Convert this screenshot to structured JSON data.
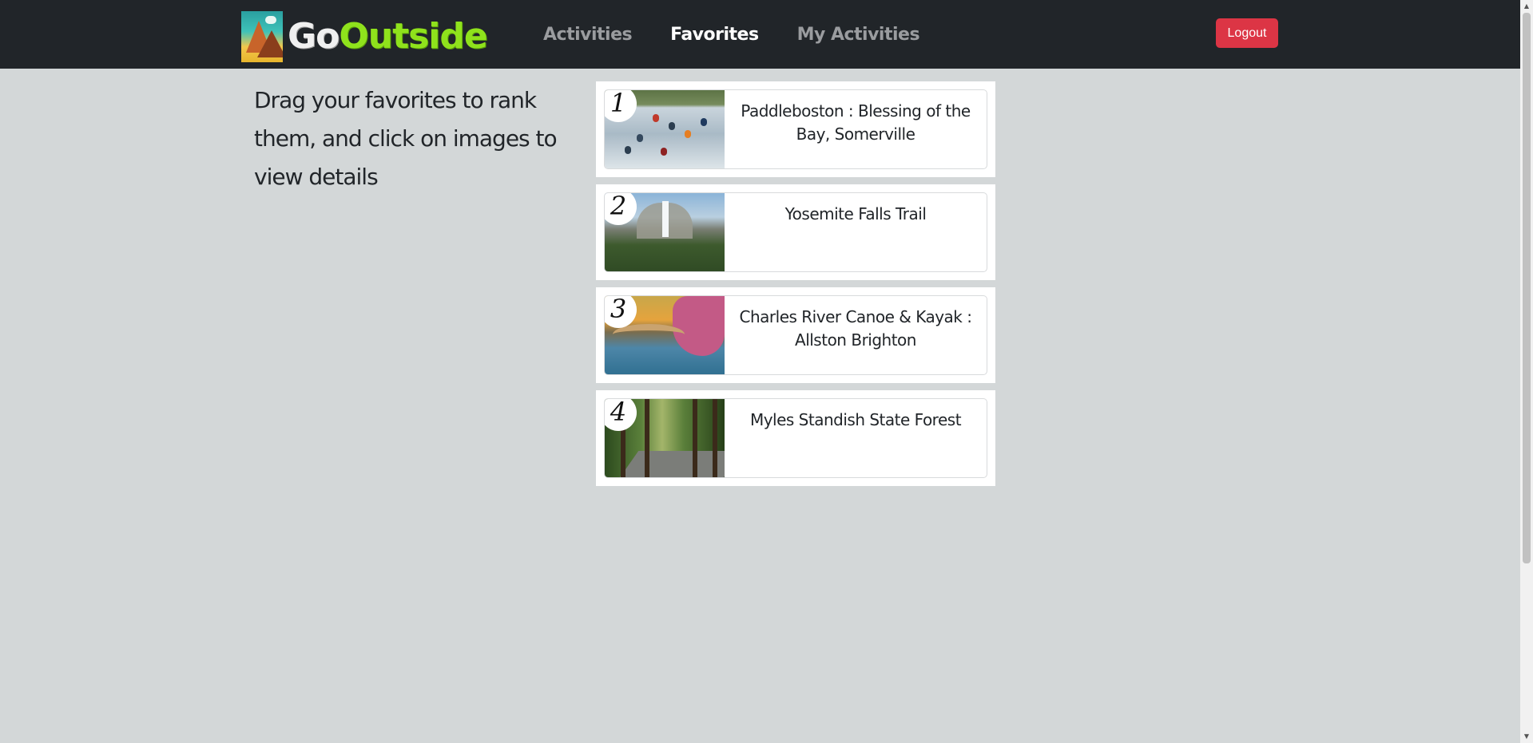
{
  "navbar": {
    "brand": {
      "part1": "Go",
      "part2": "Outside",
      "logo_icon": "mountain-logo-icon"
    },
    "links": [
      {
        "label": "Activities",
        "active": false
      },
      {
        "label": "Favorites",
        "active": true
      },
      {
        "label": "My Activities",
        "active": false
      }
    ],
    "logout_label": "Logout",
    "logout_color": "#dc3545"
  },
  "instructions": "Drag your favorites to rank them, and click on images to view details",
  "favorites": [
    {
      "rank": "1",
      "title": "Paddleboston : Blessing of the Bay, Somerville"
    },
    {
      "rank": "2",
      "title": "Yosemite Falls Trail"
    },
    {
      "rank": "3",
      "title": "Charles River Canoe & Kayak : Allston Brighton"
    },
    {
      "rank": "4",
      "title": "Myles Standish State Forest"
    }
  ],
  "colors": {
    "navbar_bg": "#212529",
    "page_bg": "#d3d7d8",
    "active_link": "#ffffff",
    "inactive_link": "#9a9c9f"
  }
}
